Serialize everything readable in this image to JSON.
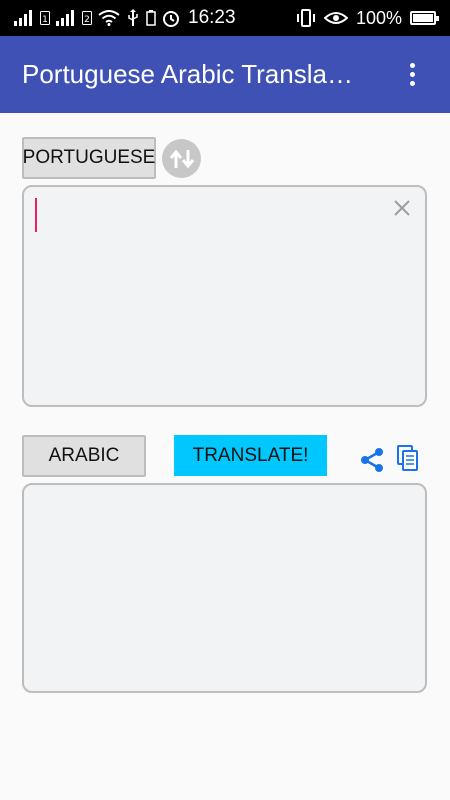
{
  "status_bar": {
    "time": "16:23",
    "battery_percent": "100%",
    "battery_level": 1.0
  },
  "app_bar": {
    "title": "Portuguese Arabic Transla…",
    "menu_icon": "more-vert-icon"
  },
  "source": {
    "language_button": "PORTUGUESE",
    "swap_icon": "swap-arrows-icon",
    "input_value": "",
    "clear_icon": "close-icon"
  },
  "target": {
    "language_button": "ARABIC",
    "translate_button": "TRANSLATE!",
    "share_icon": "share-icon",
    "copy_icon": "copy-icon",
    "output_value": ""
  },
  "colors": {
    "app_bar": "#3f51b5",
    "translate_button": "#00c8ff",
    "cursor": "#e91e63",
    "action_icons": "#1a73e8"
  }
}
